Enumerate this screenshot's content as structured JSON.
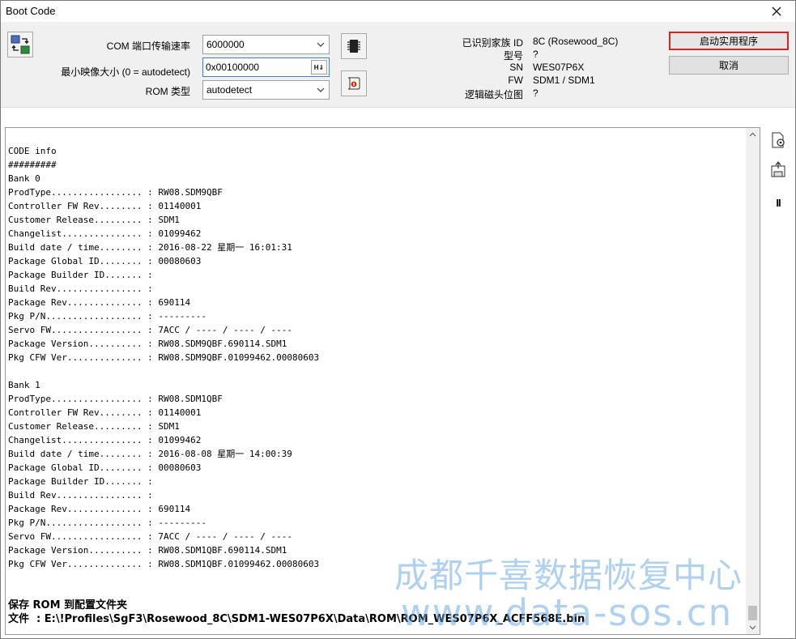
{
  "window": {
    "title": "Boot Code"
  },
  "toolbar": {
    "com_speed_label": "COM 端口传输速率",
    "com_speed_value": "6000000",
    "min_image_label": "最小映像大小 (0 = autodetect)",
    "min_image_value": "0x00100000",
    "hex_toggle_label": "H⇓",
    "rom_type_label": "ROM 类型",
    "rom_type_value": "autodetect"
  },
  "device_info": {
    "family_label": "已识别家族 ID",
    "family_value": "8C (Rosewood_8C)",
    "model_label": "型号",
    "model_value": "?",
    "sn_label": "SN",
    "sn_value": "WES07P6X",
    "fw_label": "FW",
    "fw_value": "SDM1 / SDM1",
    "head_map_label": "逻辑磁头位图",
    "head_map_value": "?"
  },
  "actions": {
    "start_label": "启动实用程序",
    "cancel_label": "取消"
  },
  "log": {
    "lines": [
      "CODE info",
      "#########",
      "Bank 0",
      "ProdType................. : RW08.SDM9QBF",
      "Controller FW Rev........ : 01140001",
      "Customer Release......... : SDM1",
      "Changelist............... : 01099462",
      "Build date / time........ : 2016-08-22 星期一 16:01:31",
      "Package Global ID........ : 00080603",
      "Package Builder ID....... :",
      "Build Rev................ :",
      "Package Rev.............. : 690114",
      "Pkg P/N.................. : ---------",
      "Servo FW................. : 7ACC / ---- / ---- / ----",
      "Package Version.......... : RW08.SDM9QBF.690114.SDM1",
      "Pkg CFW Ver.............. : RW08.SDM9QBF.01099462.00080603",
      "",
      "Bank 1",
      "ProdType................. : RW08.SDM1QBF",
      "Controller FW Rev........ : 01140001",
      "Customer Release......... : SDM1",
      "Changelist............... : 01099462",
      "Build date / time........ : 2016-08-08 星期一 14:00:39",
      "Package Global ID........ : 00080603",
      "Package Builder ID....... :",
      "Build Rev................ :",
      "Package Rev.............. : 690114",
      "Pkg P/N.................. : ---------",
      "Servo FW................. : 7ACC / ---- / ---- / ----",
      "Package Version.......... : RW08.SDM1QBF.690114.SDM1",
      "Pkg CFW Ver.............. : RW08.SDM1QBF.01099462.00080603",
      "",
      "",
      "保存 ROM 到配置文件夹",
      "文件  : E:\\!Profiles\\SgF3\\Rosewood_8C\\SDM1-WES07P6X\\Data\\ROM\\ROM_WES07P6X_ACFF568E.bin"
    ]
  },
  "side_icons": {
    "pause_glyph": "II"
  },
  "watermark": {
    "line1": "成都千喜数据恢复中心",
    "line2": "www.data-sos.cn"
  }
}
